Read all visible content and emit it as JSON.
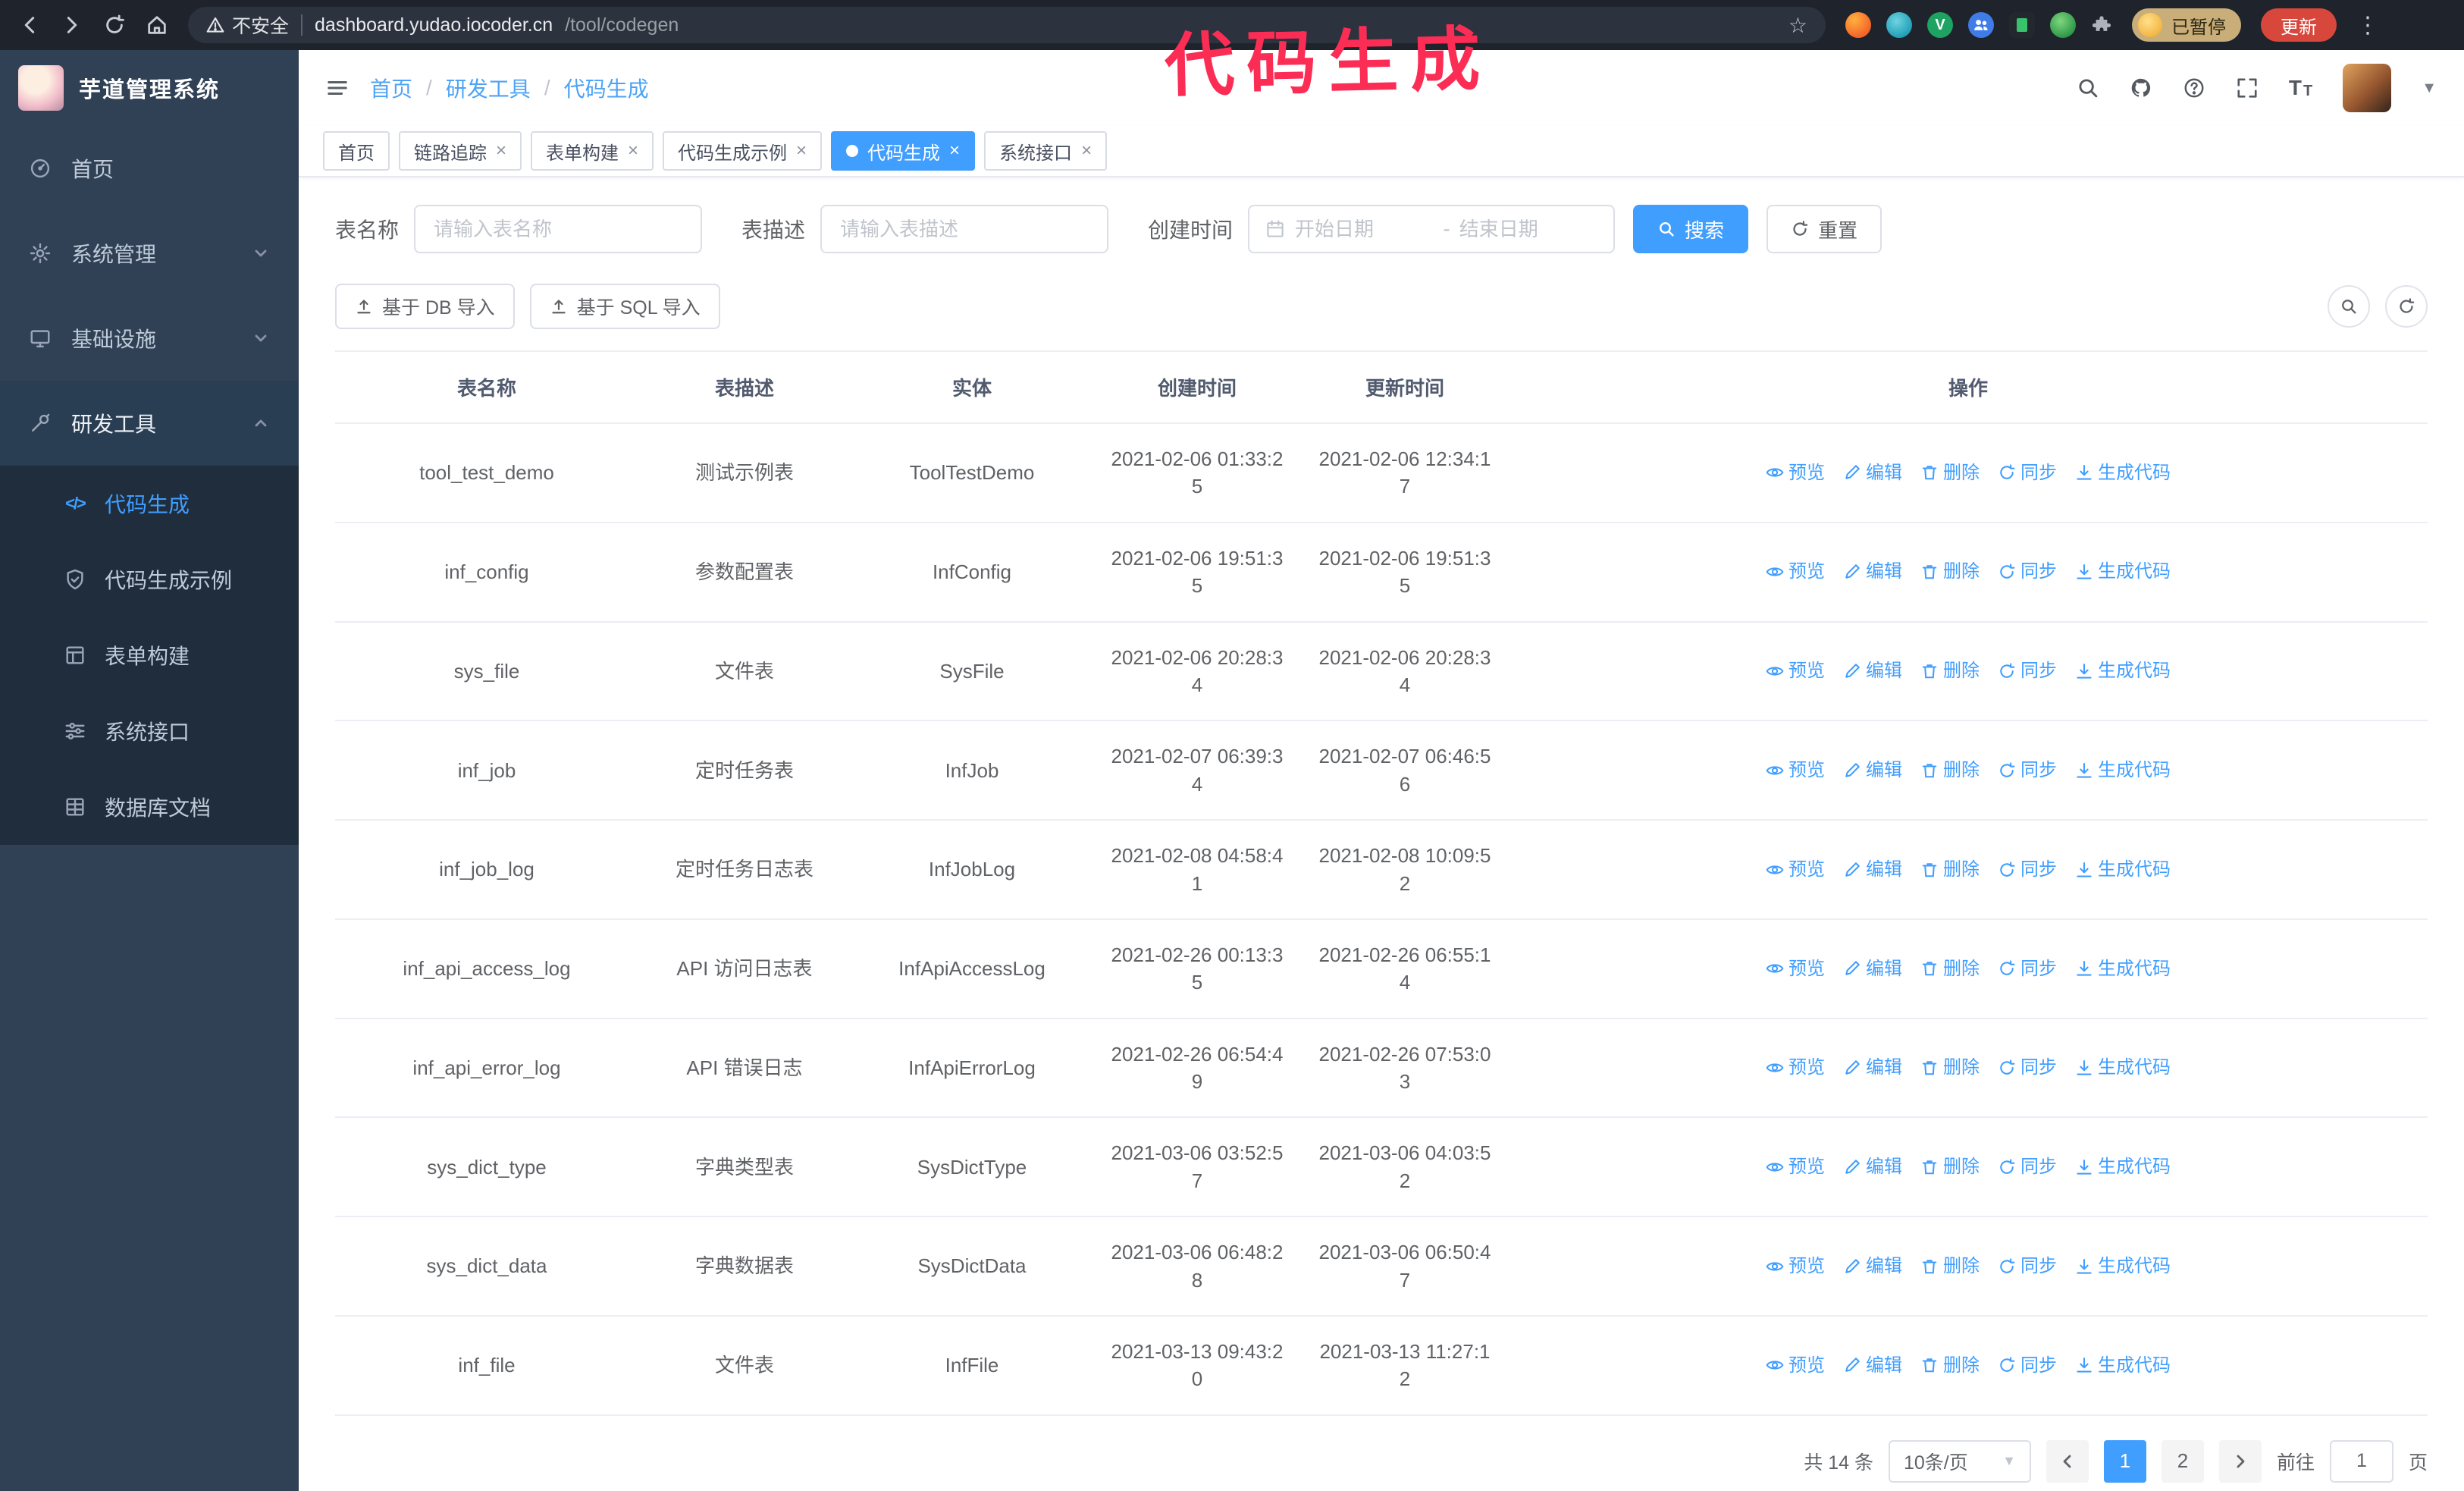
{
  "colors": {
    "accent": "#409eff",
    "sidebar_bg": "#304156",
    "submenu_bg": "#1f2d3d",
    "active_tag_bg": "#409eff",
    "annotation": "#fb2d55",
    "update_button_bg": "#d8473c",
    "paused_badge_bg": "#c9ae79"
  },
  "browser": {
    "security_label": "不安全",
    "url_host": "dashboard.yudao.iocoder.cn",
    "url_path": "/tool/codegen",
    "paused_badge": "已暂停",
    "update_button": "更新"
  },
  "annotation": "代码生成",
  "sidebar": {
    "logo_title": "芋道管理系统",
    "items": [
      {
        "label": "首页"
      },
      {
        "label": "系统管理"
      },
      {
        "label": "基础设施"
      },
      {
        "label": "研发工具"
      }
    ],
    "subitems": [
      {
        "label": "代码生成",
        "active": true
      },
      {
        "label": "代码生成示例"
      },
      {
        "label": "表单构建"
      },
      {
        "label": "系统接口"
      },
      {
        "label": "数据库文档"
      }
    ]
  },
  "header": {
    "breadcrumb": [
      "首页",
      "研发工具",
      "代码生成"
    ],
    "separator": "/"
  },
  "tabs": [
    {
      "label": "首页",
      "closable": false,
      "active": false
    },
    {
      "label": "链路追踪",
      "closable": true,
      "active": false
    },
    {
      "label": "表单构建",
      "closable": true,
      "active": false
    },
    {
      "label": "代码生成示例",
      "closable": true,
      "active": false
    },
    {
      "label": "代码生成",
      "closable": true,
      "active": true
    },
    {
      "label": "系统接口",
      "closable": true,
      "active": false
    }
  ],
  "filters": {
    "name_label": "表名称",
    "name_placeholder": "请输入表名称",
    "desc_label": "表描述",
    "desc_placeholder": "请输入表描述",
    "time_label": "创建时间",
    "start_placeholder": "开始日期",
    "range_separator": "-",
    "end_placeholder": "结束日期",
    "search_button": "搜索",
    "reset_button": "重置"
  },
  "toolbar": {
    "import_db_button": "基于 DB 导入",
    "import_sql_button": "基于 SQL 导入"
  },
  "table": {
    "columns": [
      "表名称",
      "表描述",
      "实体",
      "创建时间",
      "更新时间",
      "操作"
    ],
    "actions": [
      "预览",
      "编辑",
      "删除",
      "同步",
      "生成代码"
    ],
    "rows": [
      {
        "name": "tool_test_demo",
        "desc": "测试示例表",
        "entity": "ToolTestDemo",
        "created": "2021-02-06 01:33:25",
        "updated": "2021-02-06 12:34:17"
      },
      {
        "name": "inf_config",
        "desc": "参数配置表",
        "entity": "InfConfig",
        "created": "2021-02-06 19:51:35",
        "updated": "2021-02-06 19:51:35"
      },
      {
        "name": "sys_file",
        "desc": "文件表",
        "entity": "SysFile",
        "created": "2021-02-06 20:28:34",
        "updated": "2021-02-06 20:28:34"
      },
      {
        "name": "inf_job",
        "desc": "定时任务表",
        "entity": "InfJob",
        "created": "2021-02-07 06:39:34",
        "updated": "2021-02-07 06:46:56"
      },
      {
        "name": "inf_job_log",
        "desc": "定时任务日志表",
        "entity": "InfJobLog",
        "created": "2021-02-08 04:58:41",
        "updated": "2021-02-08 10:09:52"
      },
      {
        "name": "inf_api_access_log",
        "desc": "API 访问日志表",
        "entity": "InfApiAccessLog",
        "created": "2021-02-26 00:13:35",
        "updated": "2021-02-26 06:55:14"
      },
      {
        "name": "inf_api_error_log",
        "desc": "API 错误日志",
        "entity": "InfApiErrorLog",
        "created": "2021-02-26 06:54:49",
        "updated": "2021-02-26 07:53:03"
      },
      {
        "name": "sys_dict_type",
        "desc": "字典类型表",
        "entity": "SysDictType",
        "created": "2021-03-06 03:52:57",
        "updated": "2021-03-06 04:03:52"
      },
      {
        "name": "sys_dict_data",
        "desc": "字典数据表",
        "entity": "SysDictData",
        "created": "2021-03-06 06:48:28",
        "updated": "2021-03-06 06:50:47"
      },
      {
        "name": "inf_file",
        "desc": "文件表",
        "entity": "InfFile",
        "created": "2021-03-13 09:43:20",
        "updated": "2021-03-13 11:27:12"
      }
    ]
  },
  "pagination": {
    "total": "共 14 条",
    "page_size": "10条/页",
    "pages": [
      "1",
      "2"
    ],
    "active_page": "1",
    "goto_label": "前往",
    "goto_value": "1",
    "page_unit": "页"
  }
}
